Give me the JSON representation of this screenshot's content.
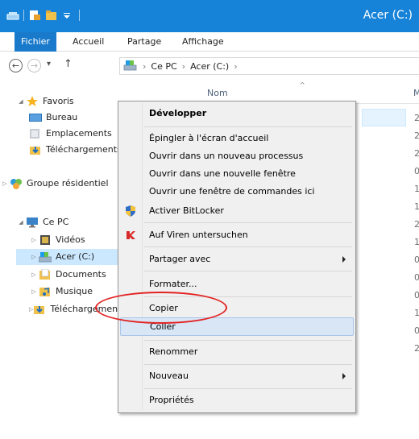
{
  "window": {
    "title": "Acer (C:)"
  },
  "ribbon": {
    "tabs": [
      "Fichier",
      "Accueil",
      "Partage",
      "Affichage"
    ]
  },
  "address": {
    "back": "←",
    "forward": "→",
    "dropdown": "▾",
    "up": "↑",
    "separator": "›",
    "path": [
      "Ce PC",
      "Acer (C:)"
    ]
  },
  "nav": {
    "items": [
      {
        "label": "Favoris",
        "caret": "◢",
        "icon": "star-icon"
      },
      {
        "label": "Bureau",
        "caret": "",
        "icon": "desktop-icon"
      },
      {
        "label": "Emplacements",
        "caret": "",
        "icon": "recent-places-icon"
      },
      {
        "label": "Téléchargements",
        "caret": "",
        "icon": "downloads-icon"
      },
      {
        "label": "Groupe résidentiel",
        "caret": "▷",
        "icon": "homegroup-icon"
      },
      {
        "label": "Ce PC",
        "caret": "◢",
        "icon": "computer-icon"
      },
      {
        "label": "Vidéos",
        "caret": "▷",
        "icon": "videos-icon"
      },
      {
        "label": "Acer (C:)",
        "caret": "▷",
        "icon": "drive-icon"
      },
      {
        "label": "Documents",
        "caret": "▷",
        "icon": "documents-icon"
      },
      {
        "label": "Musique",
        "caret": "▷",
        "icon": "music-icon"
      },
      {
        "label": "Téléchargements",
        "caret": "▷",
        "icon": "downloads-icon"
      }
    ]
  },
  "content": {
    "column_name": "Nom",
    "column_modified": "M",
    "sort_indicator": "^",
    "dates": [
      "2",
      "2",
      "2",
      "0",
      "1",
      "1",
      "2",
      "1",
      "0",
      "0",
      "0",
      "1",
      "0",
      "2"
    ]
  },
  "menu": {
    "items": [
      {
        "label": "Développer",
        "bold": true
      },
      {
        "label": "Épingler à l'écran d'accueil"
      },
      {
        "label": "Ouvrir dans un nouveau processus"
      },
      {
        "label": "Ouvrir dans une nouvelle fenêtre"
      },
      {
        "label": "Ouvrir une fenêtre de commandes ici"
      },
      {
        "label": "Activer BitLocker",
        "icon": "bitlocker-shield-icon"
      },
      {
        "label": "Auf Viren untersuchen",
        "icon": "kaspersky-icon"
      },
      {
        "label": "Partager avec",
        "submenu": true
      },
      {
        "label": "Formater..."
      },
      {
        "label": "Copier"
      },
      {
        "label": "Coller",
        "highlighted": true
      },
      {
        "label": "Renommer"
      },
      {
        "label": "Nouveau",
        "submenu": true
      },
      {
        "label": "Propriétés"
      }
    ]
  },
  "colors": {
    "titlebar": "#1683d8",
    "file_tab": "#1979ca",
    "selection": "#cce8ff",
    "menu_highlight": "#d8e6f6",
    "annotation_circle": "#e32222"
  }
}
